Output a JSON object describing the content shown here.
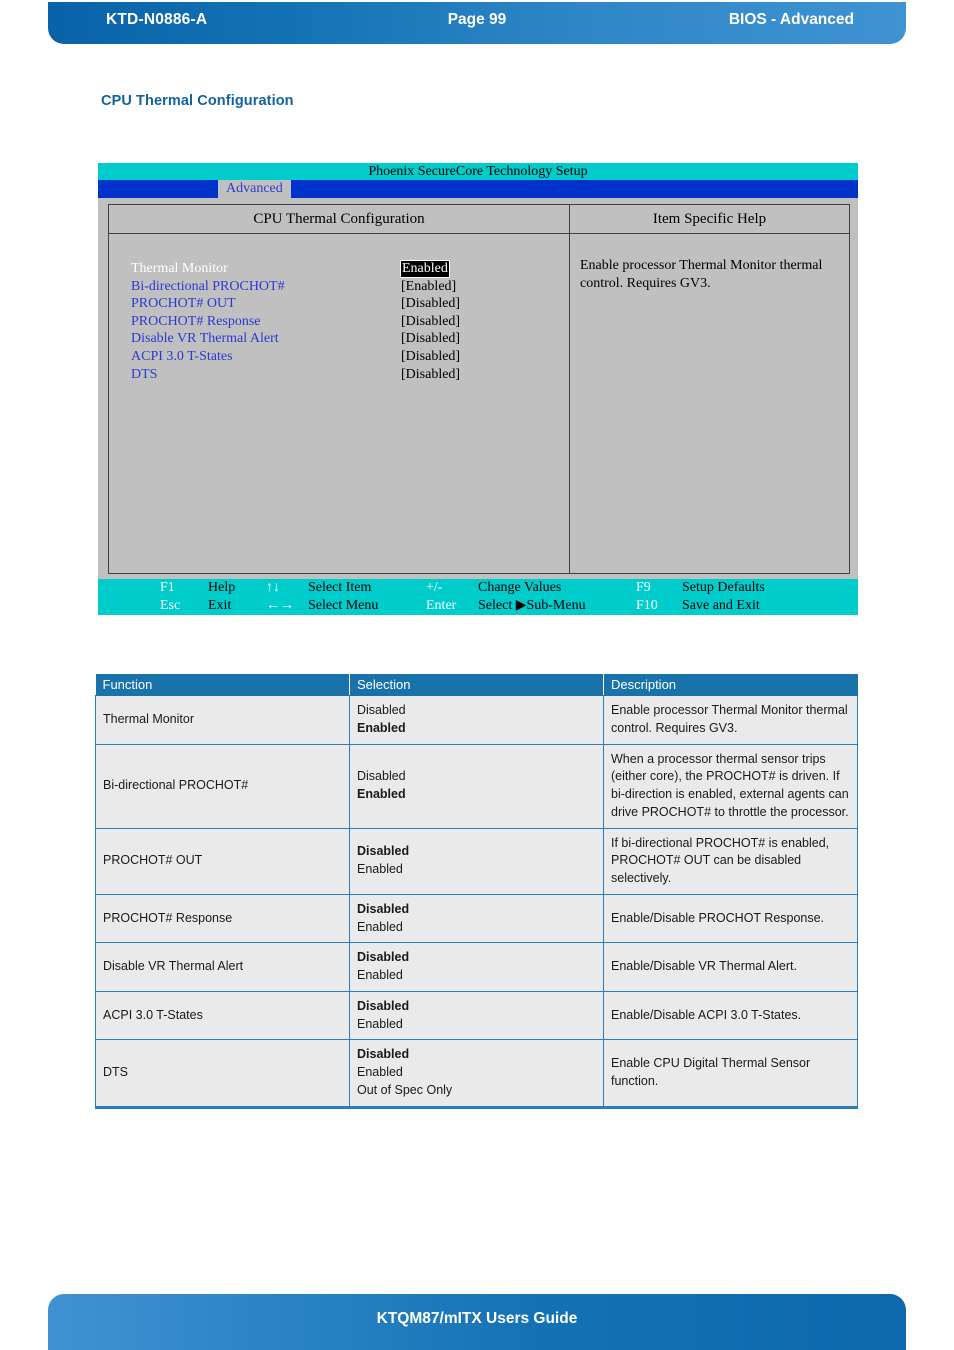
{
  "header": {
    "doc_code": "KTD-N0886-A",
    "page_label": "Page 99",
    "section": "BIOS  - Advanced"
  },
  "section_heading": "CPU Thermal Configuration",
  "bios": {
    "title": "Phoenix SecureCore Technology Setup",
    "menu_tab": "Advanced",
    "left_panel_title": "CPU Thermal Configuration",
    "right_panel_title": "Item Specific Help",
    "help_text": "Enable processor Thermal Monitor thermal control. Requires GV3.",
    "settings": [
      {
        "label": "Thermal Monitor",
        "value": "Enabled",
        "selected": true
      },
      {
        "label": "Bi-directional PROCHOT#",
        "value": "[Enabled]",
        "selected": false
      },
      {
        "label": "PROCHOT# OUT",
        "value": "[Disabled]",
        "selected": false
      },
      {
        "label": "PROCHOT# Response",
        "value": "[Disabled]",
        "selected": false
      },
      {
        "label": "Disable VR Thermal Alert",
        "value": "[Disabled]",
        "selected": false
      },
      {
        "label": "ACPI 3.0 T-States",
        "value": "[Disabled]",
        "selected": false
      },
      {
        "label": "DTS",
        "value": "[Disabled]",
        "selected": false
      }
    ],
    "keybar": {
      "row1": [
        {
          "key": "F1",
          "action": "Help"
        },
        {
          "key": "↑↓",
          "action": "Select Item"
        },
        {
          "key": "+/-",
          "action": "Change Values"
        },
        {
          "key": "F9",
          "action": "Setup Defaults"
        }
      ],
      "row2": [
        {
          "key": "Esc",
          "action": "Exit"
        },
        {
          "key": "←→",
          "action": "Select Menu"
        },
        {
          "key": "Enter",
          "action": "Select ▶Sub-Menu"
        },
        {
          "key": "F10",
          "action": "Save and Exit"
        }
      ]
    }
  },
  "table": {
    "columns": [
      "Function",
      "Selection",
      "Description"
    ],
    "rows": [
      {
        "function": "Thermal Monitor",
        "options": [
          {
            "text": "Disabled",
            "bold": false
          },
          {
            "text": "Enabled",
            "bold": true
          }
        ],
        "description": "Enable processor Thermal Monitor thermal control. Requires GV3."
      },
      {
        "function": "Bi-directional PROCHOT#",
        "options": [
          {
            "text": "Disabled",
            "bold": false
          },
          {
            "text": "Enabled",
            "bold": true
          }
        ],
        "description": "When a processor thermal sensor trips (either core), the PROCHOT# is driven. If bi-direction is enabled, external agents can drive PROCHOT# to throttle the processor."
      },
      {
        "function": "PROCHOT# OUT",
        "options": [
          {
            "text": "Disabled",
            "bold": true
          },
          {
            "text": "Enabled",
            "bold": false
          }
        ],
        "description": "If bi-directional PROCHOT# is enabled, PROCHOT# OUT can be disabled selectively."
      },
      {
        "function": "PROCHOT# Response",
        "options": [
          {
            "text": "Disabled",
            "bold": true
          },
          {
            "text": "Enabled",
            "bold": false
          }
        ],
        "description": "Enable/Disable PROCHOT Response."
      },
      {
        "function": "Disable VR Thermal Alert",
        "options": [
          {
            "text": "Disabled",
            "bold": true
          },
          {
            "text": "Enabled",
            "bold": false
          }
        ],
        "description": "Enable/Disable VR Thermal Alert."
      },
      {
        "function": "ACPI 3.0 T-States",
        "options": [
          {
            "text": "Disabled",
            "bold": true
          },
          {
            "text": "Enabled",
            "bold": false
          }
        ],
        "description": "Enable/Disable ACPI 3.0 T-States."
      },
      {
        "function": "DTS",
        "options": [
          {
            "text": "Disabled",
            "bold": true
          },
          {
            "text": "Enabled",
            "bold": false
          },
          {
            "text": "Out of Spec Only",
            "bold": false
          }
        ],
        "description": "Enable CPU Digital Thermal Sensor function."
      }
    ]
  },
  "footer": {
    "guide_title": "KTQM87/mITX Users Guide"
  },
  "colors": {
    "brand_blue": "#1a72ab",
    "heading_blue": "#13629f",
    "bios_title_cyan": "#00cccc",
    "bios_menu_blue": "#0033cc",
    "bios_bg": "#c0c0c0",
    "bios_item_blue": "#2b3ad0",
    "table_row_bg": "#eaeaea",
    "table_border": "#2a7fba"
  }
}
